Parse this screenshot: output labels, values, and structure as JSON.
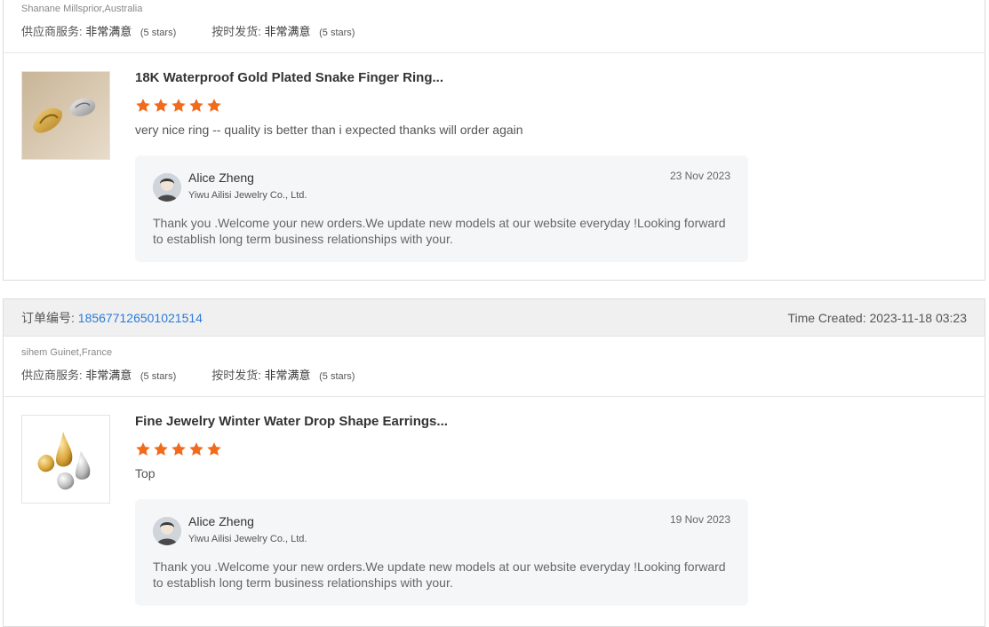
{
  "reviews": [
    {
      "buyer": "Shanane Millsprior,Australia",
      "supplier_service_label": "供应商服务:",
      "supplier_service_value": "非常满意",
      "supplier_service_stars": "(5 stars)",
      "ontime_label": "按时发货:",
      "ontime_value": "非常满意",
      "ontime_stars": "(5 stars)",
      "product_title": "18K Waterproof Gold Plated Snake Finger Ring...",
      "rating": 5,
      "review_text": "very nice ring -- quality is better than i expected thanks will order again",
      "reply": {
        "name": "Alice Zheng",
        "company": "Yiwu Ailisi Jewelry Co., Ltd.",
        "date": "23 Nov 2023",
        "text": "Thank you .Welcome your new orders.We update new models at our website everyday !Looking forward to establish long term business relationships with your."
      }
    },
    {
      "order_label": "订单编号:",
      "order_number": "185677126501021514",
      "time_label": "Time Created:",
      "time_value": "2023-11-18 03:23",
      "buyer": "sihem Guinet,France",
      "supplier_service_label": "供应商服务:",
      "supplier_service_value": "非常满意",
      "supplier_service_stars": "(5 stars)",
      "ontime_label": "按时发货:",
      "ontime_value": "非常满意",
      "ontime_stars": "(5 stars)",
      "product_title": "Fine Jewelry Winter Water Drop Shape Earrings...",
      "rating": 5,
      "review_text": "Top",
      "reply": {
        "name": "Alice Zheng",
        "company": "Yiwu Ailisi Jewelry Co., Ltd.",
        "date": "19 Nov 2023",
        "text": "Thank you .Welcome your new orders.We update new models at our website everyday !Looking forward to establish long term business relationships with your."
      }
    }
  ],
  "colors": {
    "star": "#f26a1b",
    "link": "#2b7bd8",
    "header_bg": "#f0f0f0",
    "reply_bg": "#f5f6f8"
  },
  "icons": {
    "star": "star-icon",
    "avatar": "avatar-photo"
  }
}
